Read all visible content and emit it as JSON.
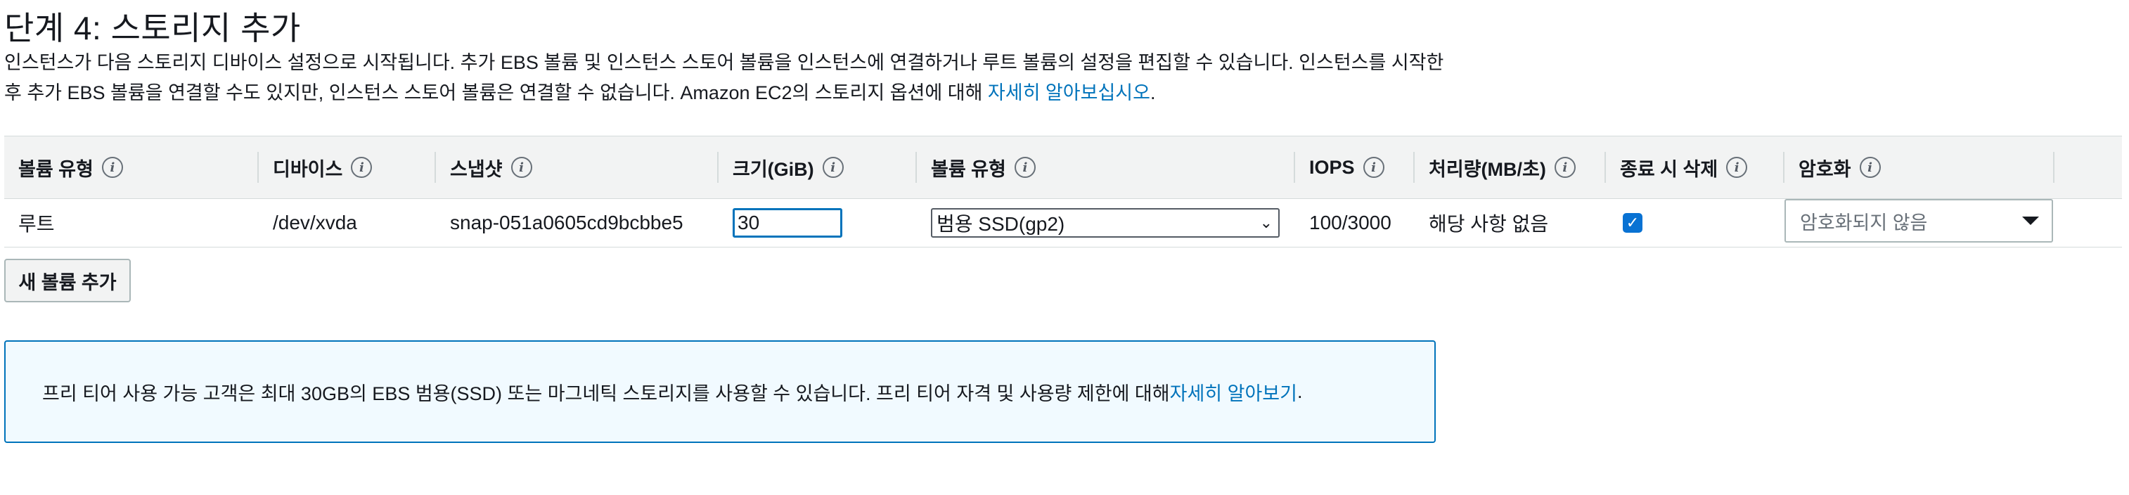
{
  "page": {
    "title": "단계 4: 스토리지 추가",
    "description_prefix": "인스턴스가 다음 스토리지 디바이스 설정으로 시작됩니다. 추가 EBS 볼륨 및 인스턴스 스토어 볼륨을 인스턴스에 연결하거나 루트 볼륨의 설정을 편집할 수 있습니다. 인스턴스를 시작한 후 추가 EBS 볼륨을 연결할 수도 있지만, 인스턴스 스토어 볼륨은 연결할 수 없습니다. Amazon EC2의 스토리지 옵션에 대해 ",
    "description_link": "자세히 알아보십시오",
    "description_suffix": "."
  },
  "table": {
    "headers": {
      "volume_type": "볼륨 유형",
      "device": "디바이스",
      "snapshot": "스냅샷",
      "size": "크기(GiB)",
      "volume_kind": "볼륨 유형",
      "iops": "IOPS",
      "throughput": "처리량(MB/초)",
      "delete_on_termination": "종료 시 삭제",
      "encryption": "암호화"
    },
    "row": {
      "volume_type": "루트",
      "device": "/dev/xvda",
      "snapshot": "snap-051a0605cd9bcbbe5",
      "size": "30",
      "volume_kind": "범용 SSD(gp2)",
      "iops": "100/3000",
      "throughput": "해당 사항 없음",
      "delete_on_termination": true,
      "encryption": "암호화되지 않음"
    }
  },
  "actions": {
    "add_volume": "새 볼륨 추가"
  },
  "alert": {
    "text": "프리 티어 사용 가능 고객은 최대 30GB의 EBS 범용(SSD) 또는 마그네틱 스토리지를 사용할 수 있습니다. 프리 티어 자격 및 사용량 제한에 대해 ",
    "link": "자세히 알아보기",
    "suffix": "."
  },
  "icons": {
    "info": "i",
    "check": "✓",
    "chevron": "⌄"
  },
  "colors": {
    "link": "#0073bb",
    "header_bg": "#f2f3f3",
    "alert_bg": "#f1faff",
    "alert_border": "#0073bb",
    "checkbox": "#0972d3"
  }
}
